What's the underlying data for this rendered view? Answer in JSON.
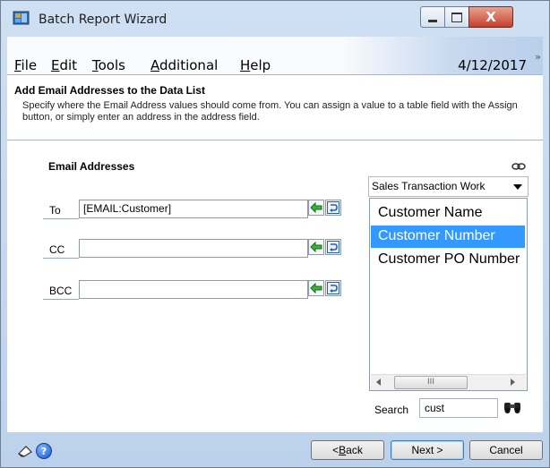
{
  "window": {
    "title": "Batch Report Wizard",
    "close_glyph": "X"
  },
  "menu": {
    "items": [
      {
        "pre": "",
        "key": "F",
        "post": "ile"
      },
      {
        "pre": "",
        "key": "E",
        "post": "dit"
      },
      {
        "pre": "",
        "key": "T",
        "post": "ools"
      },
      {
        "pre": "",
        "key": "A",
        "post": "dditional"
      },
      {
        "pre": "",
        "key": "H",
        "post": "elp"
      }
    ],
    "date": "4/12/2017",
    "overflow_glyph": "»"
  },
  "header": {
    "title": "Add Email Addresses to the Data List",
    "description": "Specify where the Email Address values should come from.  You can assign a value to a table field with the Assign button, or simply enter an address in the address field."
  },
  "email": {
    "section_title": "Email Addresses",
    "rows": [
      {
        "label": "To",
        "value": "[EMAIL:Customer]"
      },
      {
        "label": "CC",
        "value": ""
      },
      {
        "label": "BCC",
        "value": ""
      }
    ]
  },
  "fields_panel": {
    "table_select": "Sales Transaction Work",
    "items": [
      "Customer Name",
      "Customer Number",
      "Customer PO Number"
    ],
    "selected_index": 1,
    "scroll_thumb": "III",
    "search_label": "Search",
    "search_value": "cust"
  },
  "footer": {
    "back_pre": "< ",
    "back_key": "B",
    "back_post": "ack",
    "next_label": "Next >",
    "cancel_label": "Cancel",
    "help_glyph": "?"
  },
  "icons": [
    "app-icon",
    "minimize-icon",
    "maximize-icon",
    "close-icon",
    "link-icon",
    "assign-arrow-icon",
    "revert-icon",
    "scroll-left-icon",
    "scroll-right-icon",
    "binoculars-icon",
    "note-icon",
    "help-icon"
  ]
}
